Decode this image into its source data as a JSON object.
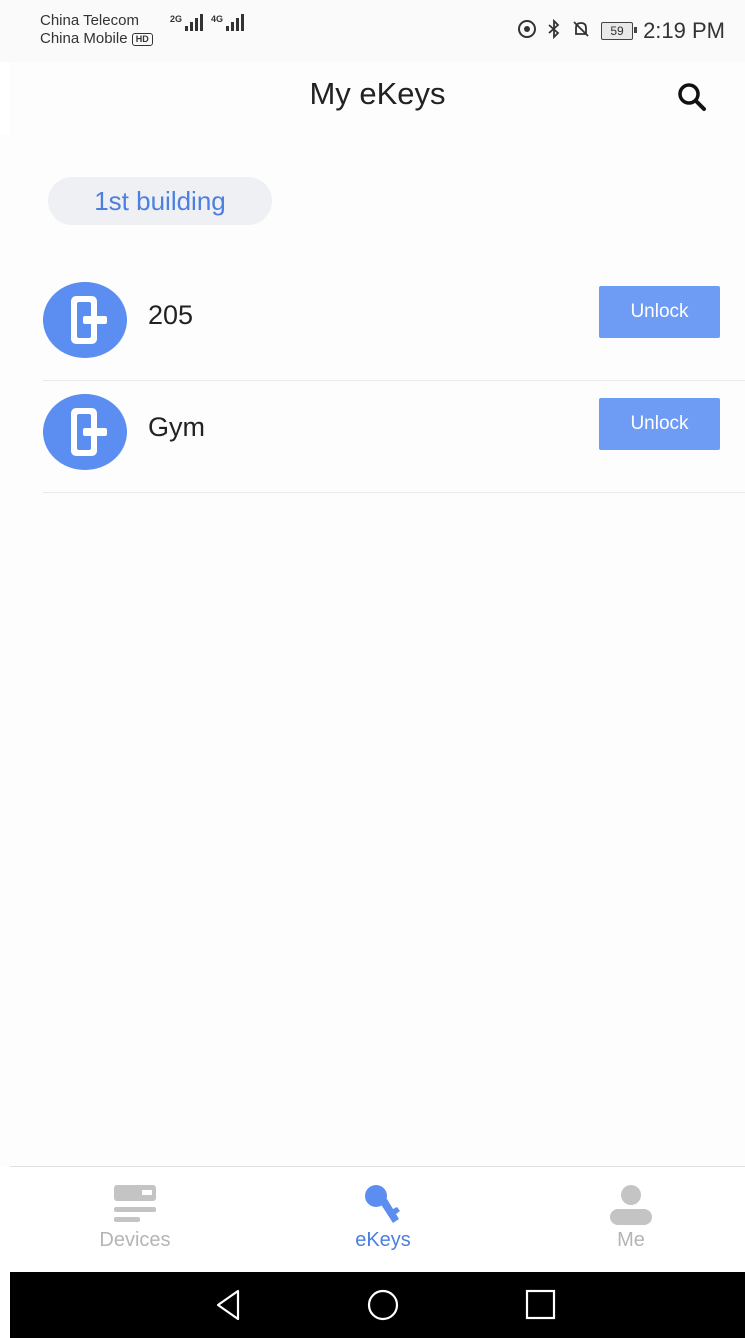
{
  "status_bar": {
    "carrier_1": "China Telecom",
    "carrier_2": "China Mobile",
    "hd_badge": "HD",
    "signal_1_tag": "2G",
    "signal_2_tag": "4G",
    "battery_level": "59",
    "time": "2:19 PM"
  },
  "header": {
    "title": "My eKeys",
    "search_icon": "search-icon"
  },
  "group": {
    "label": "1st building"
  },
  "ekeys": [
    {
      "name": "205",
      "action_label": "Unlock",
      "icon": "door-lock-icon"
    },
    {
      "name": "Gym",
      "action_label": "Unlock",
      "icon": "door-lock-icon"
    }
  ],
  "tabs": [
    {
      "label": "Devices",
      "icon": "devices-icon",
      "active": false
    },
    {
      "label": "eKeys",
      "icon": "key-icon",
      "active": true
    },
    {
      "label": "Me",
      "icon": "person-icon",
      "active": false
    }
  ],
  "colors": {
    "accent": "#5b8ef0",
    "button": "#6e9cf4",
    "chip_text": "#4b7fe0",
    "tab_inactive": "#b5b5b5"
  },
  "nav_buttons": [
    "back-icon",
    "home-icon",
    "recents-icon"
  ]
}
